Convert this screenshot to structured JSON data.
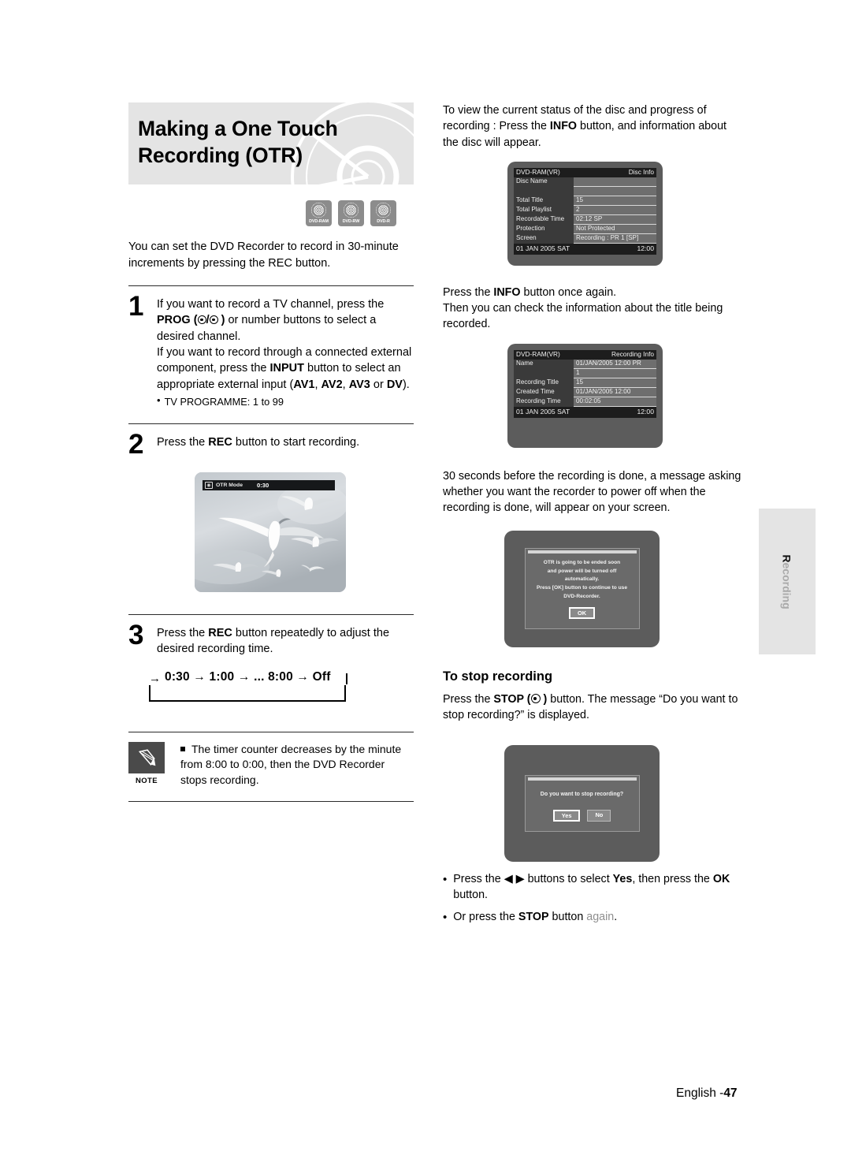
{
  "header": {
    "title_line1": "Making a One Touch",
    "title_line2": "Recording (OTR)",
    "disc_badges": [
      "DVD-RAM",
      "DVD-RW",
      "DVD-R"
    ]
  },
  "left": {
    "intro": "You can set the DVD Recorder to record in 30-minute increments by pressing the REC button.",
    "steps": [
      {
        "number": "1",
        "text_a": "If you want to record a TV channel, press the ",
        "prog_label": "PROG",
        "text_b": " or number buttons to select a desired channel.",
        "text_c": "If you want to record through a connected external component, press the ",
        "input_label": "INPUT",
        "text_d": " button to select an appropriate external input (",
        "av1": "AV1",
        "av2": "AV2",
        "av3": "AV3",
        "dv": "DV",
        "text_e": ").",
        "bullet": "TV PROGRAMME: 1 to 99"
      },
      {
        "number": "2",
        "text_a": "Press the ",
        "rec_label": "REC",
        "text_b": " button to start recording."
      },
      {
        "number": "3",
        "text_a": "Press the ",
        "rec_label": "REC",
        "text_b": " button repeatedly to adjust the desired recording time."
      }
    ],
    "otr_screen": {
      "mode_label": "OTR Mode",
      "timer": "0:30"
    },
    "loop_diagram": "0:30 → 1:00 → ... 8:00 → Off",
    "note": {
      "label": "NOTE",
      "text": "The timer counter decreases by the minute from 8:00 to 0:00, then the DVD Recorder stops recording."
    }
  },
  "right": {
    "para1_a": "To view the current status of the disc and progress of recording : Press the ",
    "para1_info": "INFO",
    "para1_b": " button, and information about the disc will appear.",
    "disc_info": {
      "disc_type": "DVD-RAM(VR)",
      "screen_title": "Disc Info",
      "rows": [
        {
          "key": "Disc Name",
          "value": ""
        },
        {
          "key": "",
          "value": ""
        },
        {
          "key": "Total Title",
          "value": "15"
        },
        {
          "key": "Total Playlist",
          "value": "2"
        },
        {
          "key": "Recordable Time",
          "value": "02:12  SP"
        },
        {
          "key": "Protection",
          "value": "Not Protected"
        },
        {
          "key": "Screen",
          "value": "Recording :  PR 1 [SP]"
        }
      ],
      "footer_date": "01 JAN 2005 SAT",
      "footer_time": "12:00"
    },
    "para2_a": "Press the ",
    "para2_info": "INFO",
    "para2_b": " button once again.",
    "para2_c": "Then you can check the information about the title being recorded.",
    "recording_info": {
      "disc_type": "DVD-RAM(VR)",
      "screen_title": "Recording Info",
      "rows": [
        {
          "key": "Name",
          "value": "01/JAN/2005 12:00 PR"
        },
        {
          "key": "",
          "value": "1"
        },
        {
          "key": "Recording Title",
          "value": "15"
        },
        {
          "key": "Created Time",
          "value": "01/JAN/2005 12:00"
        },
        {
          "key": "Recording Time",
          "value": "00:02:05"
        }
      ],
      "footer_date": "01 JAN 2005 SAT",
      "footer_time": "12:00"
    },
    "para3": "30 seconds before the recording is done, a message asking whether you want the recorder to power off when the recording is done, will appear on your screen.",
    "otr_end_dialog": {
      "line1": "OTR is going to be ended soon",
      "line2": "and power will be turned off automatically.",
      "line3": "Press [OK] button to continue to use DVD-Recorder.",
      "ok_button": "OK"
    },
    "stop_heading": "To stop recording",
    "stop_para_a": "Press the ",
    "stop_label": "STOP",
    "stop_para_b": " button. The message “Do you want to stop recording?” is displayed.",
    "stop_dialog": {
      "message": "Do you want to stop recording?",
      "yes_button": "Yes",
      "no_button": "No"
    },
    "bullets": [
      {
        "a": "Press the ◀ ▶ buttons to select ",
        "bold1": "Yes",
        "b": ", then press the ",
        "bold2": "OK",
        "c": " button."
      },
      {
        "a": "Or press the ",
        "bold1": "STOP",
        "b": " button ",
        "gray": "again",
        "c": "."
      }
    ]
  },
  "side_tab": {
    "first_letter": "R",
    "rest": "ecording"
  },
  "footer": {
    "lang": "English -",
    "page": "47"
  }
}
